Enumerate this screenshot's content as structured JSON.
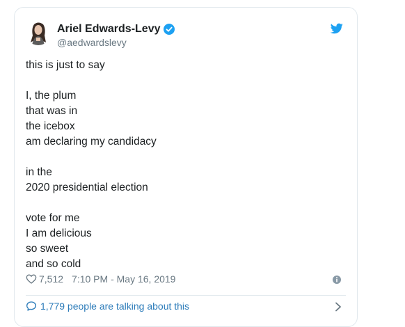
{
  "author": {
    "display_name": "Ariel Edwards-Levy",
    "handle": "@aedwardslevy",
    "verified": true
  },
  "icons": {
    "verified": "verified-badge-icon",
    "brand": "twitter-bird-icon",
    "like": "heart-icon",
    "info": "info-icon",
    "reply": "speech-bubble-icon",
    "more": "chevron-right-icon"
  },
  "tweet": {
    "text": "this is just to say\n\nI, the plum\nthat was in\nthe icebox\nam declaring my candidacy\n\nin the\n2020 presidential election\n\nvote for me\nI am delicious\nso sweet\nand so cold",
    "likes": "7,512",
    "timestamp": "7:10 PM - May 16, 2019"
  },
  "footer": {
    "talking_label": "1,779 people are talking about this"
  },
  "colors": {
    "brand_blue": "#1da1f2",
    "link_blue": "#2b7bb9",
    "muted_gray": "#697882",
    "border": "#e1e8ed"
  }
}
